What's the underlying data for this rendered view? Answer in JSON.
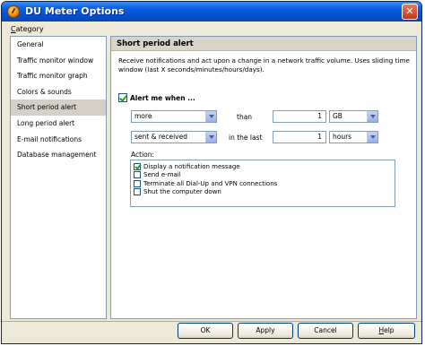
{
  "window": {
    "title": "DU Meter Options",
    "close_glyph": "✕"
  },
  "category": {
    "label_first": "C",
    "label_rest": "ategory",
    "items": [
      {
        "label": "General"
      },
      {
        "label": "Traffic monitor window"
      },
      {
        "label": "Traffic monitor graph"
      },
      {
        "label": "Colors & sounds"
      },
      {
        "label": "Short period alert",
        "selected": true
      },
      {
        "label": "Long period alert"
      },
      {
        "label": "E-mail notifications"
      },
      {
        "label": "Database management"
      }
    ]
  },
  "panel": {
    "header": "Short period alert",
    "description": "Receive notifications and act upon a change in a network traffic volume. Uses sliding time window (last X seconds/minutes/hours/days).",
    "alert_checkbox_label": "Alert me when ...",
    "alert_checked": true,
    "condition_select": "more",
    "than_label": "than",
    "amount_value": "1",
    "unit_select": "GB",
    "direction_select": "sent & received",
    "in_the_last_label": "in the last",
    "period_value": "1",
    "period_unit_select": "hours",
    "action_label": "Action:",
    "actions": [
      {
        "label": "Display a notification message",
        "checked": true
      },
      {
        "label": "Send e-mail",
        "checked": false
      },
      {
        "label": "Terminate all Dial-Up and VPN connections",
        "checked": false
      },
      {
        "label": "Shut the computer down",
        "checked": false
      }
    ]
  },
  "buttons": {
    "ok": "OK",
    "apply": "Apply",
    "cancel": "Cancel",
    "help_first": "H",
    "help_rest": "elp"
  }
}
